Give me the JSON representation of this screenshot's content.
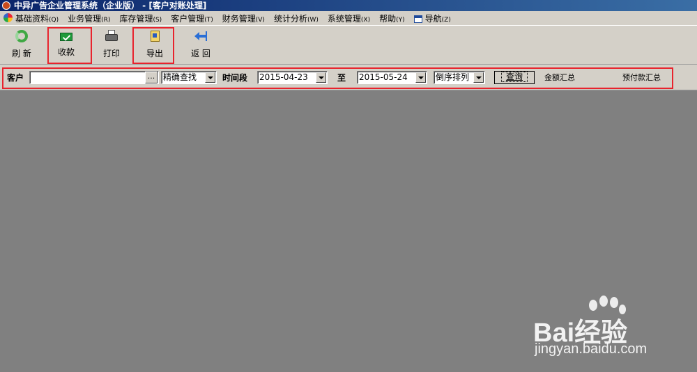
{
  "window": {
    "title": "中异广告企业管理系统（企业版） - [客户对账处理]"
  },
  "menu": {
    "items": [
      {
        "label": "基础资料",
        "accel": "(Q)"
      },
      {
        "label": "业务管理",
        "accel": "(R)"
      },
      {
        "label": "库存管理",
        "accel": "(S)"
      },
      {
        "label": "客户管理",
        "accel": "(T)"
      },
      {
        "label": "财务管理",
        "accel": "(V)"
      },
      {
        "label": "统计分析",
        "accel": "(W)"
      },
      {
        "label": "系统管理",
        "accel": "(X)"
      },
      {
        "label": "帮助",
        "accel": "(Y)"
      }
    ],
    "nav": {
      "label": "导航",
      "accel": "(Z)"
    }
  },
  "toolbar": {
    "refresh_label": "刷 新",
    "collect_label": "收款",
    "print_label": "打印",
    "export_label": "导出",
    "back_label": "返 回"
  },
  "filter": {
    "customer_label": "客户",
    "customer_value": "",
    "ellipsis": "...",
    "search_mode": "精确查找",
    "period_label": "时间段",
    "date_from": "2015-04-23",
    "to_label": "至",
    "date_to": "2015-05-24",
    "sort_order": "倒序排列",
    "query_button": "查询",
    "amount_summary": "金额汇总",
    "prepay_summary": "预付款汇总"
  },
  "watermark": {
    "brand": "Bai经验",
    "url": "jingyan.baidu.com"
  },
  "colors": {
    "highlight": "#e8232d",
    "titlebar": "#0a246a",
    "chrome": "#d4d0c8",
    "workspace": "#808080"
  }
}
